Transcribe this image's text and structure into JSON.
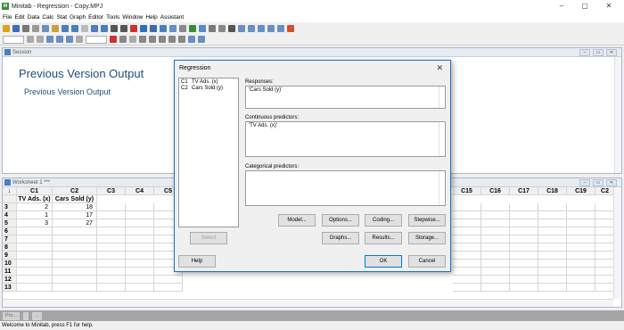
{
  "window": {
    "title": "Minitab - Regression - Copy.MPJ",
    "minimize": "–",
    "maximize": "▢",
    "close": "✕"
  },
  "menu": [
    "File",
    "Edit",
    "Data",
    "Calc",
    "Stat",
    "Graph",
    "Editor",
    "Tools",
    "Window",
    "Help",
    "Assistant"
  ],
  "session": {
    "header": "Session",
    "heading": "Previous Version Output",
    "subheading": "Previous Version Output"
  },
  "worksheet": {
    "header": "Worksheet 1 ***",
    "corner": "↓",
    "columns": [
      "C1",
      "C2",
      "C3",
      "C4",
      "C5",
      "C15",
      "C16",
      "C17",
      "C18",
      "C19",
      "C2"
    ],
    "names": [
      "TV Ads. (x)",
      "Cars Sold (y)"
    ],
    "rows": [
      {
        "num": "3",
        "c1": "2",
        "c2": "18"
      },
      {
        "num": "4",
        "c1": "1",
        "c2": "17"
      },
      {
        "num": "5",
        "c1": "3",
        "c2": "27"
      },
      {
        "num": "6",
        "c1": "",
        "c2": ""
      },
      {
        "num": "7",
        "c1": "",
        "c2": ""
      },
      {
        "num": "8",
        "c1": "",
        "c2": ""
      },
      {
        "num": "9",
        "c1": "",
        "c2": ""
      },
      {
        "num": "10",
        "c1": "",
        "c2": ""
      },
      {
        "num": "11",
        "c1": "",
        "c2": ""
      },
      {
        "num": "12",
        "c1": "",
        "c2": ""
      },
      {
        "num": "13",
        "c1": "",
        "c2": ""
      }
    ]
  },
  "minbar": [
    "Pro...",
    "",
    "..."
  ],
  "status": "Welcome to Minitab, press F1 for help.",
  "dialog": {
    "title": "Regression",
    "close": "✕",
    "variables": [
      {
        "col": "C1",
        "name": "TV Ads. (x)"
      },
      {
        "col": "C2",
        "name": "Cars Sold (y)"
      }
    ],
    "responses_label": "Responses:",
    "responses_value": "'Cars Sold (y)'",
    "continuous_label": "Continuous predictors:",
    "continuous_value": "'TV Ads. (x)'",
    "categorical_label": "Categorical predictors:",
    "categorical_value": "",
    "buttons": {
      "model": "Model...",
      "options": "Options...",
      "coding": "Coding...",
      "stepwise": "Stepwise...",
      "select": "Select",
      "graphs": "Graphs...",
      "results": "Results...",
      "storage": "Storage...",
      "help": "Help",
      "ok": "OK",
      "cancel": "Cancel"
    }
  },
  "colors": {
    "accent": "#1a73c8",
    "session_heading": "#1f4e79"
  }
}
